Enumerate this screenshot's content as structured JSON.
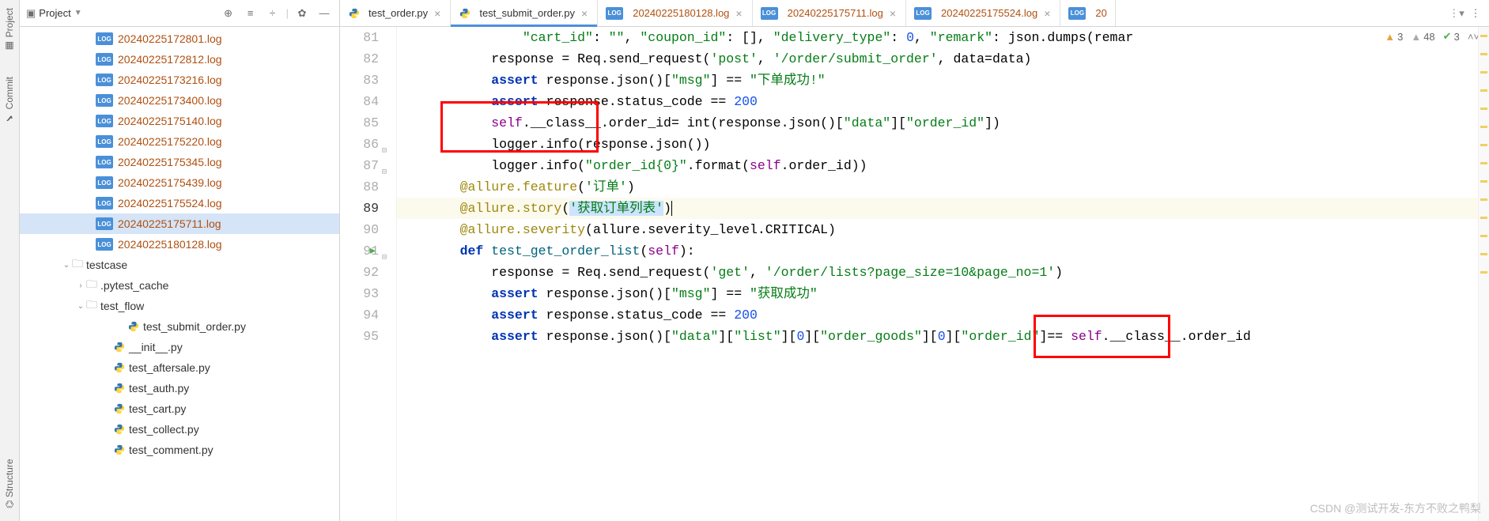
{
  "sidebar_vtabs": {
    "project": "Project",
    "commit": "Commit",
    "structure": "Structure"
  },
  "project_panel": {
    "title": "Project"
  },
  "tree": {
    "logs": [
      "20240225172801.log",
      "20240225172812.log",
      "20240225173216.log",
      "20240225173400.log",
      "20240225175140.log",
      "20240225175220.log",
      "20240225175345.log",
      "20240225175439.log",
      "20240225175524.log",
      "20240225175711.log",
      "20240225180128.log"
    ],
    "selected_log_index": 9,
    "testcase": {
      "name": "testcase",
      "pytest_cache": ".pytest_cache",
      "test_flow": {
        "name": "test_flow",
        "file": "test_submit_order.py"
      },
      "files": [
        "__init__.py",
        "test_aftersale.py",
        "test_auth.py",
        "test_cart.py",
        "test_collect.py",
        "test_comment.py"
      ]
    }
  },
  "tabs": [
    {
      "name": "test_order.py",
      "kind": "py",
      "active": false
    },
    {
      "name": "test_submit_order.py",
      "kind": "py",
      "active": true
    },
    {
      "name": "20240225180128.log",
      "kind": "log",
      "active": false
    },
    {
      "name": "20240225175711.log",
      "kind": "log",
      "active": false
    },
    {
      "name": "20240225175524.log",
      "kind": "log",
      "active": false
    },
    {
      "name": "20",
      "kind": "log",
      "active": false,
      "trunc": true
    }
  ],
  "inspections": {
    "warn1": 3,
    "warn2": 48,
    "ok": 3
  },
  "code": {
    "lines": [
      81,
      82,
      83,
      84,
      85,
      86,
      87,
      88,
      89,
      90,
      91,
      92,
      93,
      94,
      95
    ],
    "current_line": 89,
    "run_line": 91,
    "l81": {
      "k_cart": "\"cart_id\"",
      "v_cart": "\"\"",
      "k_coupon": "\"coupon_id\"",
      "v_coupon": "[]",
      "k_del": "\"delivery_type\"",
      "v_del": "0",
      "k_remark": "\"remark\"",
      "json_dumps": "json.dumps(remar"
    },
    "l82": {
      "a": "response = Req.send_request(",
      "s1": "'post'",
      "s2": "'/order/submit_order'",
      "b": ", data=data)"
    },
    "l83": {
      "kw": "assert",
      "a": " response.json()[",
      "s1": "\"msg\"",
      "b": "] == ",
      "s2": "\"下单成功!\""
    },
    "l84": {
      "kw": "assert",
      "a": " response.status_code == ",
      "n": "200"
    },
    "l85": {
      "self": "self",
      "a": ".__class__.order_id= int(response.json()[",
      "s1": "\"data\"",
      "b": "][",
      "s2": "\"order_id\"",
      "c": "])"
    },
    "l86": {
      "a": "logger.info(response.json())"
    },
    "l87": {
      "a": "logger.info(",
      "s1": "\"order_id{0}\"",
      "b": ".format(",
      "self": "self",
      "c": ".order_id))"
    },
    "l88": {
      "dec": "@allure.feature",
      "s": "'订单'"
    },
    "l89": {
      "dec": "@allure.story",
      "s": "'获取订单列表'"
    },
    "l90": {
      "dec": "@allure.severity",
      "a": "(allure.severity_level.CRITICAL)"
    },
    "l91": {
      "def": "def",
      "fn": "test_get_order_list",
      "self": "self"
    },
    "l92": {
      "a": "response = Req.send_request(",
      "s1": "'get'",
      "s2": "'/order/lists?page_size=10&page_no=1'",
      "b": ")"
    },
    "l93": {
      "kw": "assert",
      "a": " response.json()[",
      "s1": "\"msg\"",
      "b": "] == ",
      "s2": "\"获取成功\""
    },
    "l94": {
      "kw": "assert",
      "a": " response.status_code == ",
      "n": "200"
    },
    "l95": {
      "kw": "assert",
      "a": " response.json()[",
      "s1": "\"data\"",
      "b": "][",
      "s2": "\"list\"",
      "c": "][",
      "n1": "0",
      "d": "][",
      "s3": "\"order_goods\"",
      "e": "][",
      "n2": "0",
      "f": "][",
      "s4": "\"order_id\"",
      "g": "]== ",
      "self": "self",
      "h": ".__class__.order_id"
    }
  },
  "watermark": "CSDN @测试开发-东方不败之鸭梨"
}
